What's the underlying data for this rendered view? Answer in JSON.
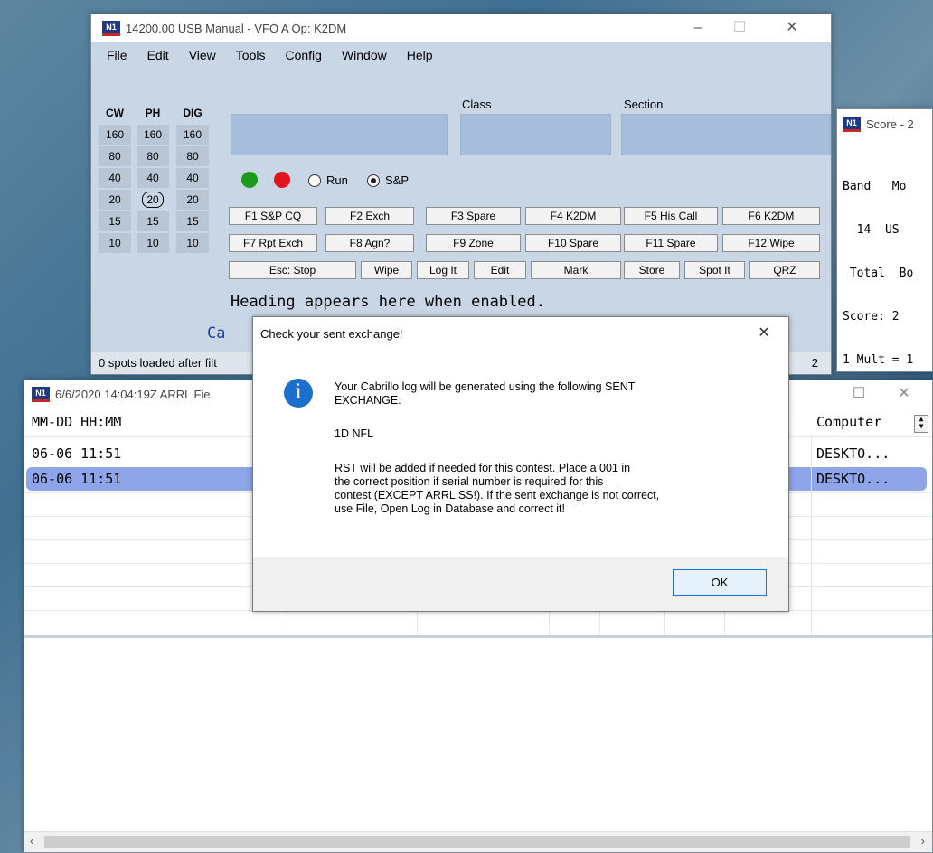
{
  "entry_window": {
    "title": "14200.00 USB Manual - VFO A   Op: K2DM",
    "menu": [
      "File",
      "Edit",
      "View",
      "Tools",
      "Config",
      "Window",
      "Help"
    ],
    "band_columns": [
      {
        "header": "CW",
        "bands": [
          "160",
          "80",
          "40",
          "20",
          "15",
          "10"
        ]
      },
      {
        "header": "PH",
        "bands": [
          "160",
          "80",
          "40",
          "20",
          "15",
          "10"
        ]
      },
      {
        "header": "DIG",
        "bands": [
          "160",
          "80",
          "40",
          "20",
          "15",
          "10"
        ]
      }
    ],
    "selected_band": "20",
    "field_labels": {
      "class": "Class",
      "section": "Section"
    },
    "radio": {
      "run": "Run",
      "sp": "S&P",
      "selected": "S&P"
    },
    "fkeys_row1": [
      "F1 S&P CQ",
      "F2 Exch",
      "F3 Spare",
      "F4 K2DM",
      "F5 His Call",
      "F6 K2DM"
    ],
    "fkeys_row2": [
      "F7 Rpt Exch",
      "F8 Agn?",
      "F9 Zone",
      "F10 Spare",
      "F11 Spare",
      "F12 Wipe"
    ],
    "buttons_row3": [
      "Esc: Stop",
      "Wipe",
      "Log It",
      "Edit",
      "Mark",
      "Store",
      "Spot It",
      "QRZ"
    ],
    "heading": "Heading appears here when enabled.",
    "partial_text": "Ca",
    "status": "0 spots loaded after filt",
    "status_right": "2"
  },
  "score_window": {
    "title": "Score - 2",
    "lines": [
      "Band   Mo",
      "  14  US",
      " Total  Bo",
      "Score: 2",
      "1 Mult = 1"
    ]
  },
  "log_window": {
    "title": "6/6/2020 14:04:19Z ARRL Fie",
    "header_left": "MM-DD HH:MM",
    "header_right": "Computer",
    "rows": [
      {
        "time": "06-06 11:51",
        "computer": "DESKTO..."
      },
      {
        "time": "06-06 11:51",
        "computer": "DESKTO..."
      }
    ]
  },
  "dialog": {
    "title": "Check your sent exchange!",
    "line1": "Your Cabrillo log will be generated using the following SENT",
    "line2": "EXCHANGE:",
    "exchange": "1D NFL",
    "para1": "RST will be added if needed for this contest.  Place a 001 in",
    "para2": "the correct position if serial number is required for this",
    "para3": "contest (EXCEPT ARRL SS!).  If the sent exchange is not correct,",
    "para4": "use File, Open Log in Database and correct it!",
    "ok": "OK"
  },
  "colors": {
    "panel": "#c9d6e6",
    "field": "#a6bddc",
    "selected_row": "#8ea5ea",
    "info_icon": "#1d6fce"
  }
}
